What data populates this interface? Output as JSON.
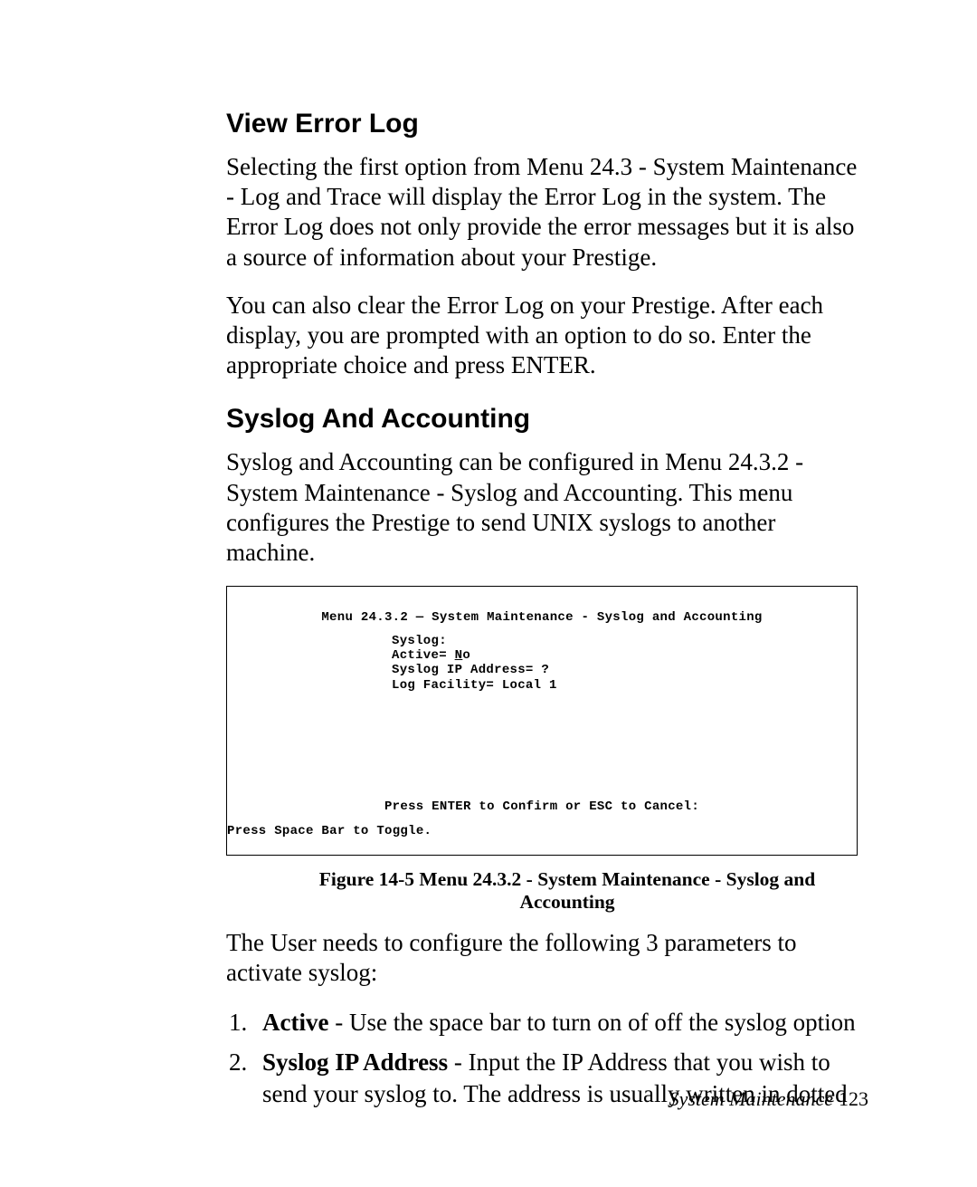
{
  "sections": {
    "view_error_log": {
      "heading": "View Error Log",
      "p1": "Selecting the first option from Menu 24.3 - System Maintenance - Log and Trace will display the Error Log in the system. The Error Log does not only provide the error messages but it is also a source of information about your Prestige.",
      "p2": "You can also clear the Error Log on your Prestige. After each display, you are prompted with an option to do so. Enter the appropriate choice and press ENTER."
    },
    "syslog": {
      "heading": "Syslog And Accounting",
      "p1": "Syslog and Accounting can be configured in Menu 24.3.2 - System Maintenance - Syslog and Accounting. This menu configures the Prestige to send UNIX syslogs to another machine.",
      "figure": {
        "title": "Menu 24.3.2 — System Maintenance - Syslog and Accounting",
        "line1": "Syslog:",
        "line2_pre": "Active= ",
        "line2_under": "N",
        "line2_post": "o",
        "line3": "Syslog IP Address= ?",
        "line4": "Log Facility= Local 1",
        "confirm": "Press ENTER to Confirm or ESC to Cancel:",
        "footer": "Press Space Bar to Toggle."
      },
      "caption": "Figure 14-5 Menu 24.3.2 - System Maintenance - Syslog and Accounting",
      "p2": "The User needs to configure the following 3 parameters to activate syslog:",
      "list": {
        "item1_bold": "Active",
        "item1_rest": " - Use the space bar to turn on of off the syslog option",
        "item2_bold": "Syslog IP Address",
        "item2_rest": " - Input the IP Address that you wish to send your syslog to. The address is usually written in dotted"
      }
    }
  },
  "footer": {
    "chapter": "System Maintenance",
    "page_number": "123"
  }
}
